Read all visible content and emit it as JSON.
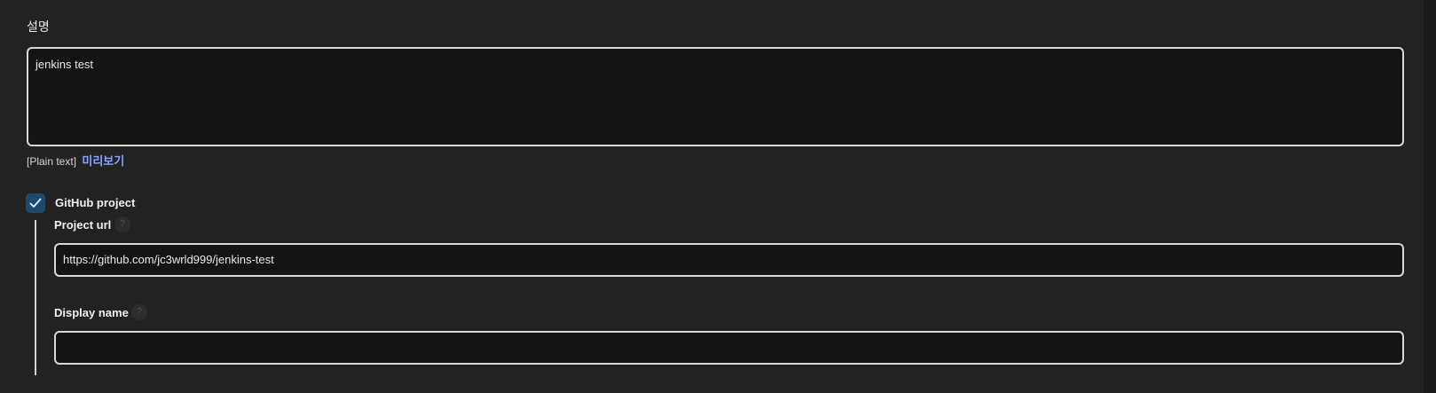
{
  "description": {
    "label": "설명",
    "value": "jenkins test",
    "format_text": "[Plain text]",
    "preview_link": "미리보기"
  },
  "github_project": {
    "label": "GitHub project",
    "checked": true,
    "project_url": {
      "label": "Project url",
      "value": "https://github.com/jc3wrld999/jenkins-test",
      "help": "?"
    },
    "display_name": {
      "label": "Display name",
      "value": "",
      "help": "?"
    }
  },
  "colors": {
    "background": "#222222",
    "field_background": "#141414",
    "field_border": "#d9d9d9",
    "link": "#8aa6ff",
    "checkbox_fill": "#1f4a6e"
  }
}
